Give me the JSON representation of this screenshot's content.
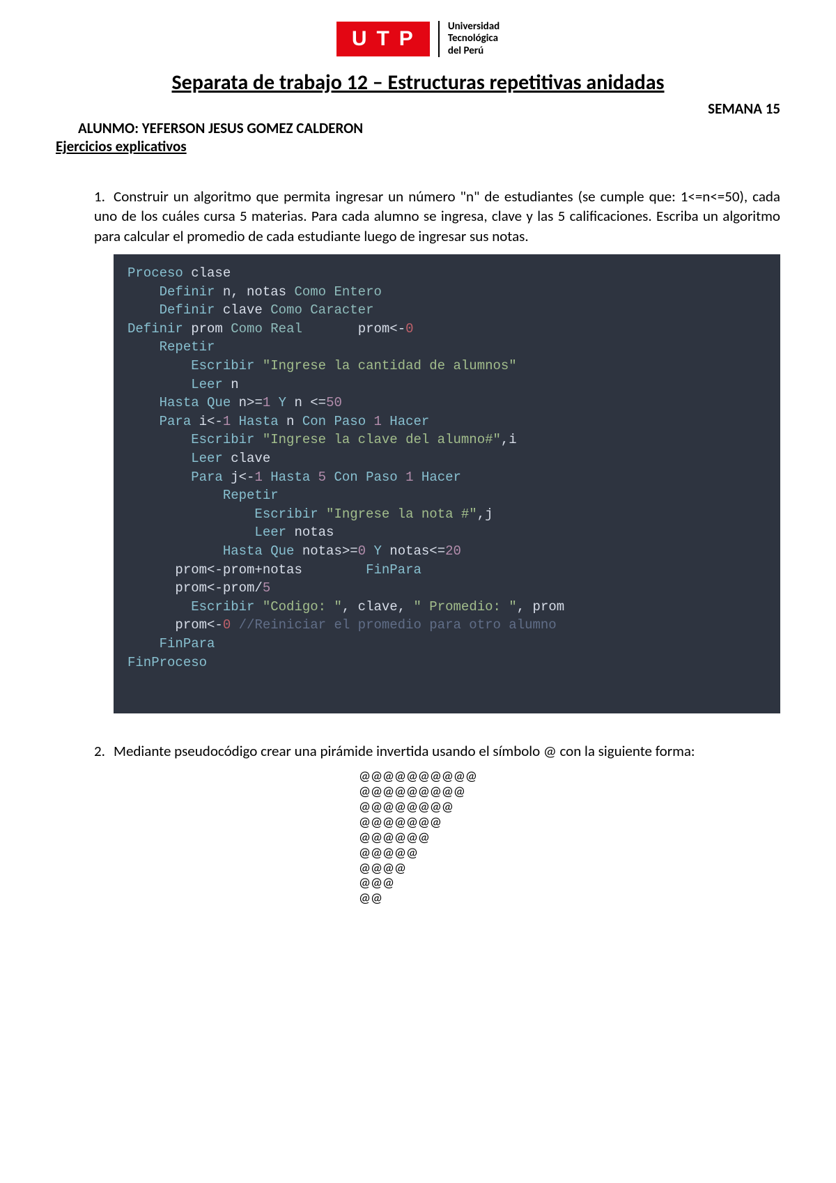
{
  "logo": {
    "letters": "UTP",
    "line1": "Universidad",
    "line2": "Tecnológica",
    "line3": "del Perú"
  },
  "title": "Separata de trabajo 12 – Estructuras repetitivas anidadas",
  "week": "SEMANA 15",
  "student_label": "ALUNMO: YEFERSON JESUS GOMEZ CALDERON",
  "section_sub": "Ejercicios explicativos",
  "ex1": {
    "num": "1.",
    "text": "Construir un algoritmo que permita ingresar un número \"n\" de estudiantes (se cumple que: 1<=n<=50), cada uno de los cuáles cursa 5 materias.  Para cada alumno se ingresa, clave y las 5 calificaciones. Escriba un algoritmo para calcular el promedio de cada estudiante luego de ingresar sus notas."
  },
  "code1": {
    "l1a": "Proceso",
    "l1b": " clase",
    "l2a": "    Definir",
    "l2b": " n, notas ",
    "l2c": "Como Entero",
    "l3a": "    Definir",
    "l3b": " clave ",
    "l3c": "Como Caracter",
    "l4a": "Definir",
    "l4b": " prom ",
    "l4c": "Como Real",
    "l4d": "       prom<-",
    "l4e": "0",
    "l5a": "    Repetir",
    "l6a": "        Escribir ",
    "l6b": "\"Ingrese la cantidad de alumnos\"",
    "l7a": "        Leer",
    "l7b": " n",
    "l8a": "    Hasta Que",
    "l8b": " n>=",
    "l8c": "1",
    "l8d": " Y",
    "l8e": " n <=",
    "l8f": "50",
    "l9a": "    Para",
    "l9b": " i<-",
    "l9c": "1",
    "l9d": " Hasta",
    "l9e": " n ",
    "l9f": "Con Paso ",
    "l9g": "1",
    "l9h": " Hacer",
    "l10a": "        Escribir ",
    "l10b": "\"Ingrese la clave del alumno#\"",
    "l10c": ",i",
    "l11a": "        Leer",
    "l11b": " clave",
    "l12a": "        Para",
    "l12b": " j<-",
    "l12c": "1",
    "l12d": " Hasta ",
    "l12e": "5",
    "l12f": " Con Paso ",
    "l12g": "1",
    "l12h": " Hacer",
    "l13a": "            Repetir",
    "l14a": "                Escribir ",
    "l14b": "\"Ingrese la nota #\"",
    "l14c": ",j",
    "l15a": "                Leer",
    "l15b": " notas",
    "l16a": "            Hasta Que",
    "l16b": " notas>=",
    "l16c": "0",
    "l16d": " Y",
    "l16e": " notas<=",
    "l16f": "20",
    "l17a": "      prom<-prom+notas        ",
    "l17b": "FinPara",
    "l18a": "      prom<-prom/",
    "l18b": "5",
    "l19a": "        Escribir ",
    "l19b": "\"Codigo: \"",
    "l19c": ", clave, ",
    "l19d": "\" Promedio: \"",
    "l19e": ", prom",
    "l20a": "      prom<-",
    "l20b": "0",
    "l20c": " //Reiniciar el promedio para otro alumno",
    "l21a": "    FinPara",
    "l22a": "FinProceso"
  },
  "ex2": {
    "num": "2.",
    "text": "Mediante pseudocódigo crear una pirámide invertida usando el símbolo @ con la siguiente forma:"
  },
  "pyramid": {
    "r1": "@@@@@@@@@@",
    "r2": "@@@@@@@@@",
    "r3": "@@@@@@@@",
    "r4": "@@@@@@@",
    "r5": "@@@@@@",
    "r6": "@@@@@",
    "r7": "@@@@",
    "r8": "@@@",
    "r9": "@@"
  }
}
